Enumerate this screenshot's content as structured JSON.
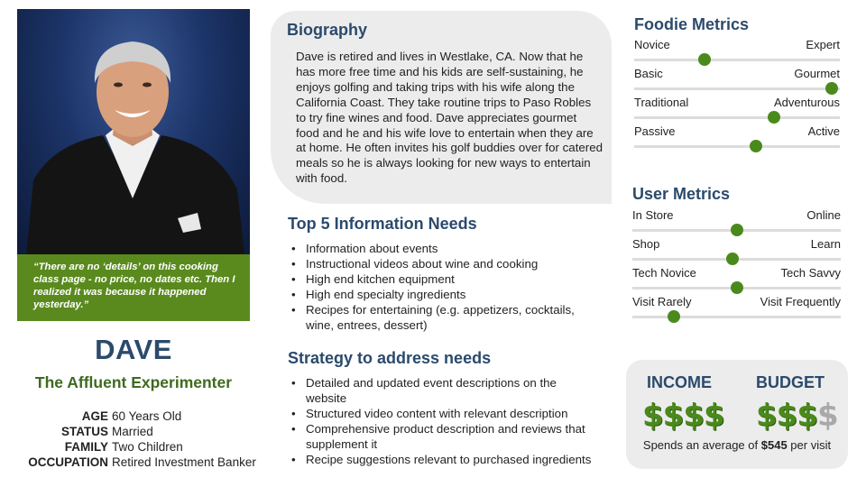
{
  "persona": {
    "quote": "“There are no ‘details’ on this cooking class page - no price, no dates etc. Then I realized it was because it happened yesterday.”",
    "name": "DAVE",
    "archetype": "The Affluent Experimenter",
    "facts": [
      {
        "label": "AGE",
        "value": "60 Years Old"
      },
      {
        "label": "STATUS",
        "value": "Married"
      },
      {
        "label": "FAMILY",
        "value": "Two Children"
      },
      {
        "label": "OCCUPATION",
        "value": "Retired Investment Banker"
      }
    ]
  },
  "biography": {
    "title": "Biography",
    "text": "Dave is retired and lives in Westlake, CA. Now that he has more free time and his kids are self-sustaining, he enjoys golfing and taking trips with his wife along the California Coast. They take routine trips to Paso Robles to try fine wines and food. Dave appreciates gourmet food and he and his wife love to entertain when they are at home. He often invites his golf buddies over for catered meals so he is always looking for new ways to entertain with food."
  },
  "needs": {
    "title": "Top 5 Information Needs",
    "items": [
      "Information about events",
      "Instructional videos about wine and cooking",
      "High end kitchen equipment",
      "High end specialty ingredients",
      "Recipes for entertaining (e.g. appetizers, cocktails, wine, entrees, dessert)"
    ]
  },
  "strategy": {
    "title": "Strategy to address needs",
    "items": [
      "Detailed and updated event descriptions on the website",
      "Structured video content with relevant description",
      "Comprehensive product description and reviews that supplement it",
      "Recipe suggestions relevant to purchased ingredients"
    ]
  },
  "foodie_metrics": {
    "title": "Foodie Metrics",
    "items": [
      {
        "left": "Novice",
        "right": "Expert",
        "level": 0.34
      },
      {
        "left": "Basic",
        "right": "Gourmet",
        "level": 0.96
      },
      {
        "left": "Traditional",
        "right": "Adventurous",
        "level": 0.68
      },
      {
        "left": "Passive",
        "right": "Active",
        "level": 0.59
      }
    ]
  },
  "user_metrics": {
    "title": "User Metrics",
    "items": [
      {
        "left": "In Store",
        "right": "Online",
        "level": 0.5
      },
      {
        "left": "Shop",
        "right": "Learn",
        "level": 0.48
      },
      {
        "left": "Tech Novice",
        "right": "Tech Savvy",
        "level": 0.5
      },
      {
        "left": "Visit Rarely",
        "right": "Visit Frequently",
        "level": 0.2
      }
    ]
  },
  "spending": {
    "income_label": "INCOME",
    "budget_label": "BUDGET",
    "income_level": 4,
    "budget_level": 3,
    "max_level": 4,
    "symbol": "$",
    "spend_prefix": "Spends an average of",
    "spend_amount": "$545",
    "spend_suffix": "per visit"
  },
  "colors": {
    "accent_green": "#4a8a1c",
    "quote_green": "#5a8a1e",
    "heading_blue": "#2b4a6c",
    "panel_gray": "#ececec"
  }
}
